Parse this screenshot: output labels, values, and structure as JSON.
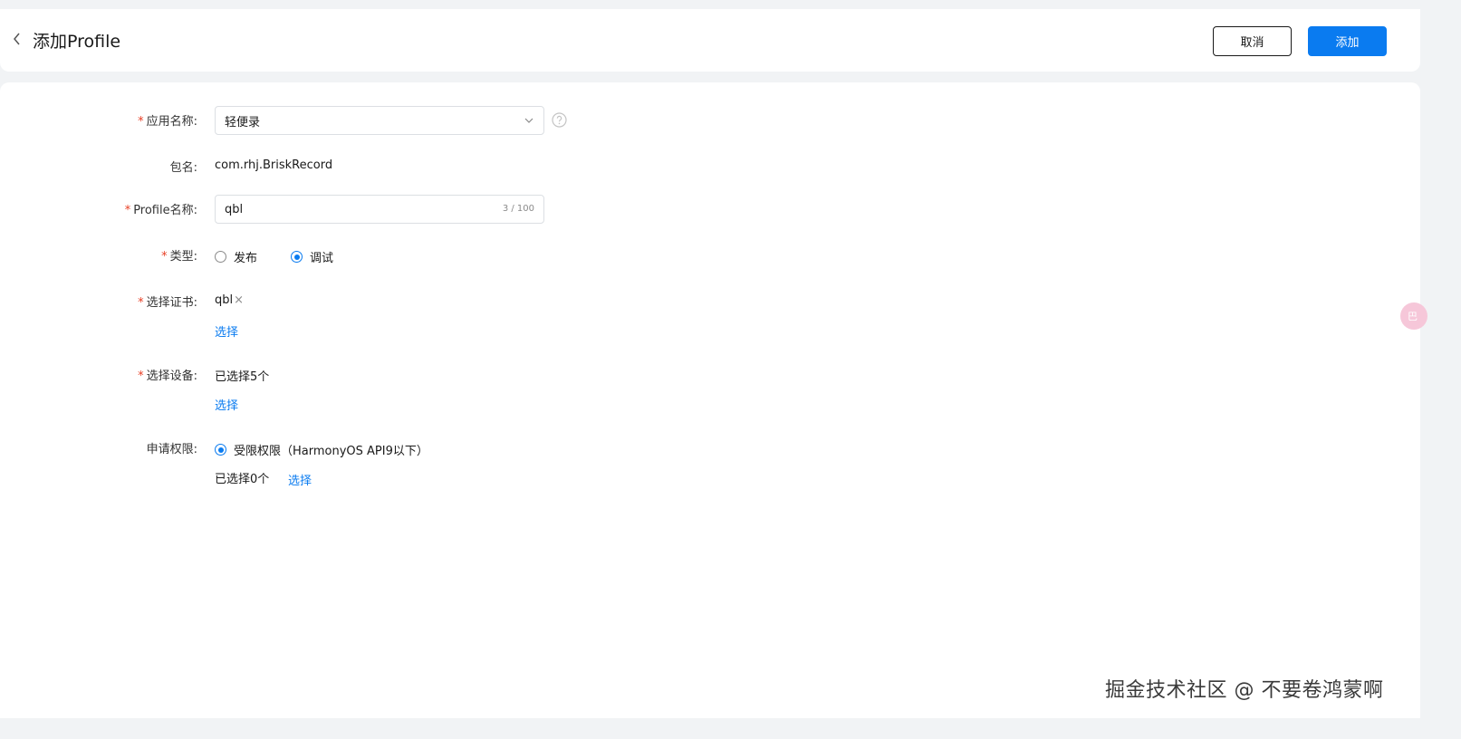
{
  "header": {
    "title": "添加Profile",
    "cancel_label": "取消",
    "add_label": "添加"
  },
  "form": {
    "app_name": {
      "label": "应用名称:",
      "value": "轻便录"
    },
    "package": {
      "label": "包名:",
      "value": "com.rhj.BriskRecord"
    },
    "profile_name": {
      "label": "Profile名称:",
      "value": "qbl",
      "counter": "3 / 100"
    },
    "type": {
      "label": "类型:",
      "options": [
        "发布",
        "调试"
      ],
      "selected": "调试"
    },
    "certificate": {
      "label": "选择证书:",
      "value": "qbl",
      "remove": "×",
      "select_link": "选择"
    },
    "devices": {
      "label": "选择设备:",
      "value": "已选择5个",
      "select_link": "选择"
    },
    "permissions": {
      "label": "申请权限:",
      "option": "受限权限（HarmonyOS API9以下）",
      "value": "已选择0个",
      "select_link": "选择"
    },
    "required_mark": "*"
  },
  "floating": {
    "label": "巴"
  },
  "watermark": "掘金技术社区 @ 不要卷鸿蒙啊",
  "colors": {
    "accent": "#0a7bf0",
    "required": "#e84026",
    "background": "#f1f3f5"
  }
}
